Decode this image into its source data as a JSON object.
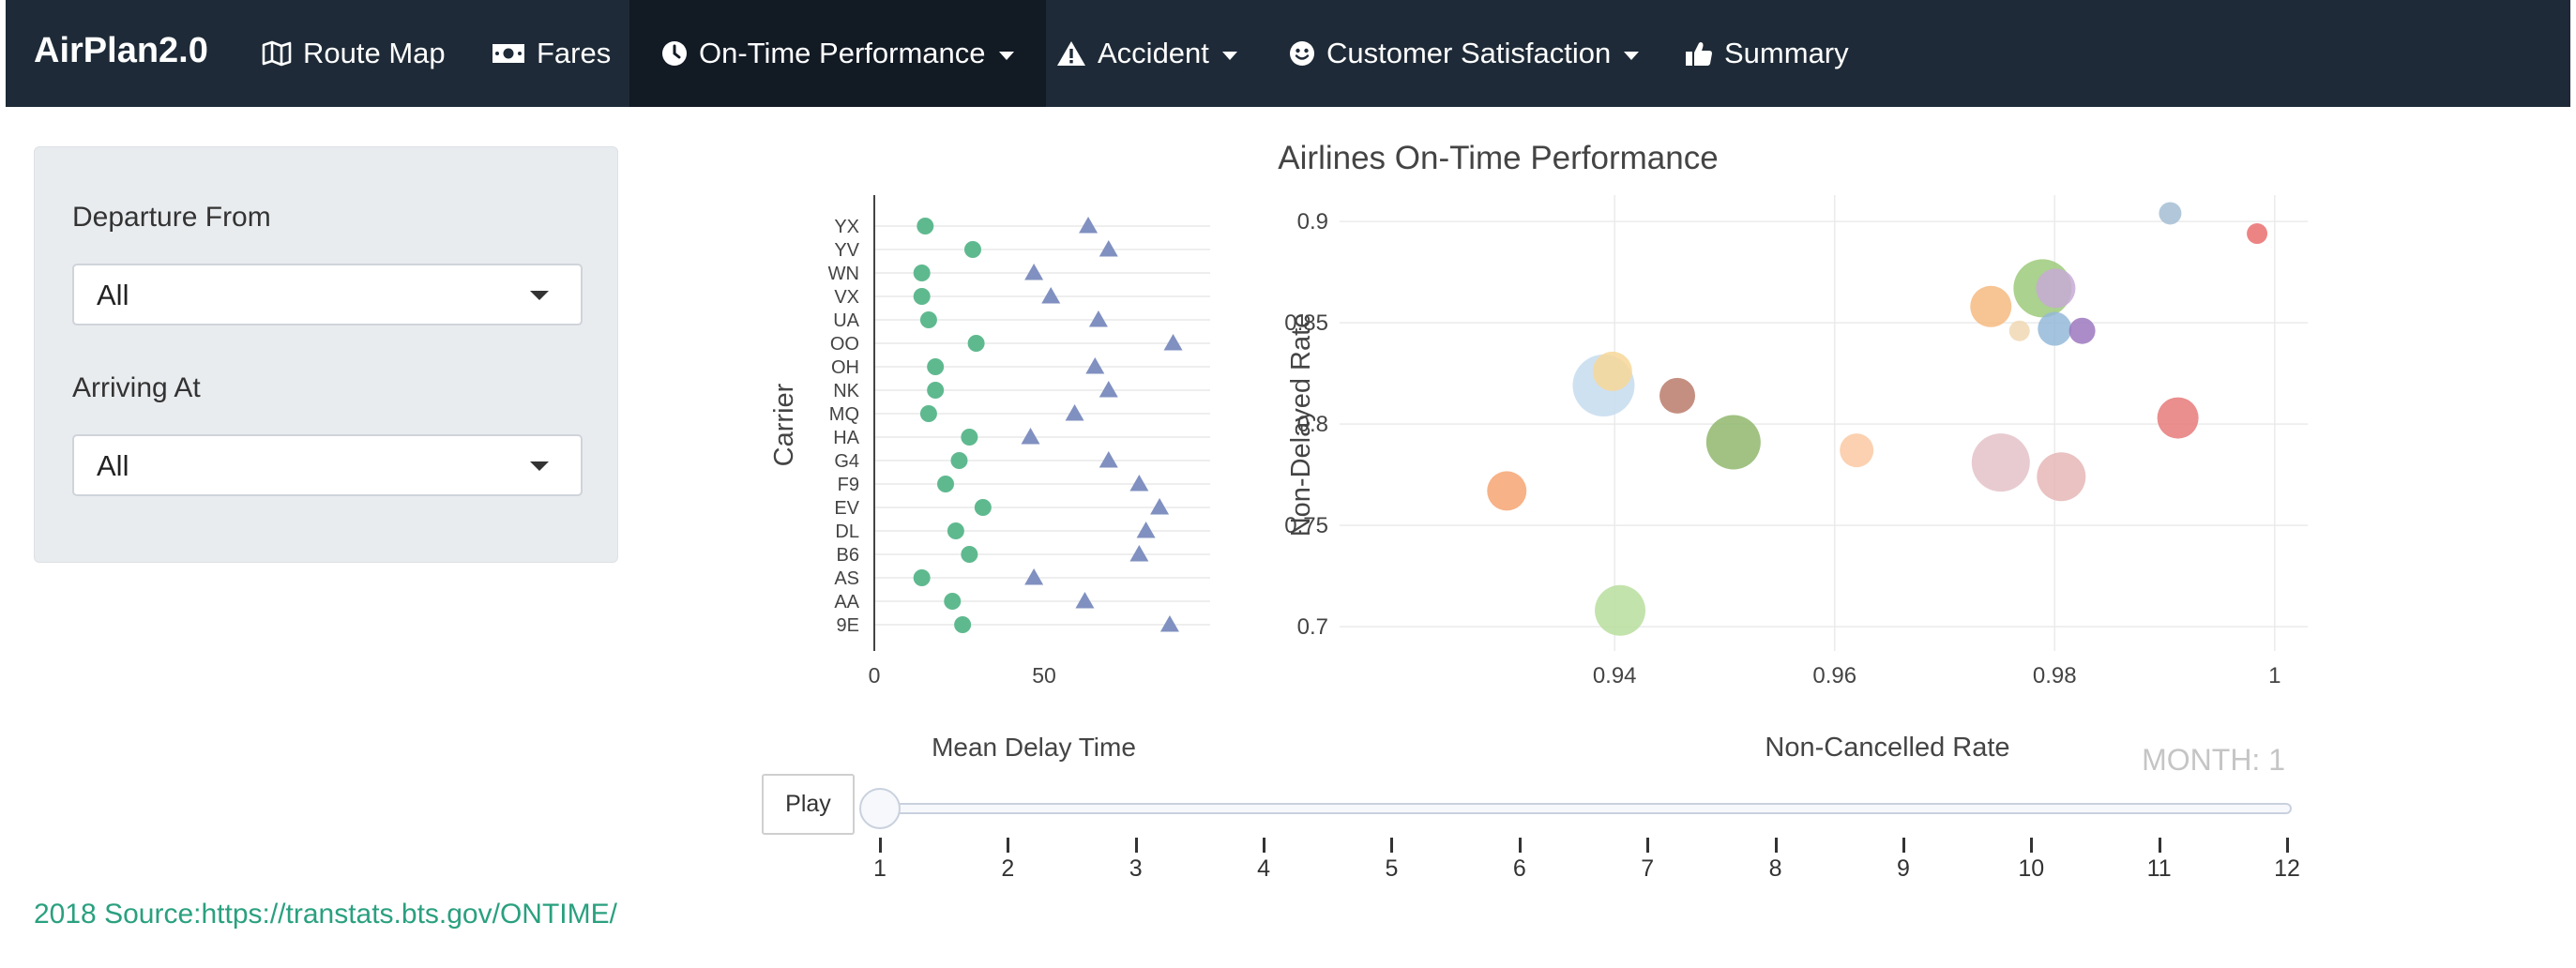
{
  "navbar": {
    "brand": "AirPlan2.0",
    "items": [
      {
        "id": "route-map",
        "label": "Route Map",
        "icon": "map-icon",
        "dropdown": false,
        "active": false
      },
      {
        "id": "fares",
        "label": "Fares",
        "icon": "money-icon",
        "dropdown": false,
        "active": false
      },
      {
        "id": "on-time-performance",
        "label": "On-Time Performance",
        "icon": "clock-icon",
        "dropdown": true,
        "active": true
      },
      {
        "id": "accident",
        "label": "Accident",
        "icon": "warning-icon",
        "dropdown": true,
        "active": false
      },
      {
        "id": "customer-satisfaction",
        "label": "Customer Satisfaction",
        "icon": "smile-icon",
        "dropdown": true,
        "active": false
      },
      {
        "id": "summary",
        "label": "Summary",
        "icon": "thumbs-up-icon",
        "dropdown": false,
        "active": false
      }
    ]
  },
  "sidebar": {
    "departure_label": "Departure From",
    "departure_value": "All",
    "arriving_label": "Arriving At",
    "arriving_value": "All"
  },
  "footer": {
    "source": "2018 Source:https://transtats.bts.gov/ONTIME/"
  },
  "slider": {
    "play_label": "Play",
    "current_label": "MONTH: 1",
    "current": 1,
    "min": 1,
    "max": 12,
    "ticks": [
      "1",
      "2",
      "3",
      "4",
      "5",
      "6",
      "7",
      "8",
      "9",
      "10",
      "11",
      "12"
    ]
  },
  "colors": {
    "navbar_bg": "#1e2a37",
    "navbar_active": "#121a24",
    "marker_circle": "#5fb98f",
    "marker_triangle": "#8090c0",
    "link": "#2aa07f"
  },
  "chart_data": [
    {
      "type": "scatter",
      "title": "",
      "xlabel": "Mean Delay Time",
      "ylabel": "Carrier",
      "xlim": [
        0,
        100
      ],
      "xticks": [
        0,
        50
      ],
      "categories": [
        "YX",
        "YV",
        "WN",
        "VX",
        "UA",
        "OO",
        "OH",
        "NK",
        "MQ",
        "HA",
        "G4",
        "F9",
        "EV",
        "DL",
        "B6",
        "AS",
        "AA",
        "9E"
      ],
      "series": [
        {
          "marker": "circle",
          "values": [
            15,
            29,
            14,
            14,
            16,
            30,
            18,
            18,
            16,
            28,
            25,
            21,
            32,
            24,
            28,
            14,
            23,
            26
          ]
        },
        {
          "marker": "triangle",
          "values": [
            63,
            69,
            47,
            52,
            66,
            88,
            65,
            69,
            59,
            46,
            69,
            78,
            84,
            80,
            78,
            47,
            62,
            87
          ]
        }
      ]
    },
    {
      "type": "scatter",
      "title": "Airlines On-Time Performance",
      "xlabel": "Non-Cancelled Rate",
      "ylabel": "Non-Delayed Rate",
      "xlim": [
        0.915,
        1.003
      ],
      "ylim": [
        0.688,
        0.913
      ],
      "xticks": [
        0.94,
        0.96,
        0.98,
        1
      ],
      "xtick_labels": [
        "0.94",
        "0.96",
        "0.98",
        "1"
      ],
      "yticks": [
        0.7,
        0.75,
        0.8,
        0.85,
        0.9
      ],
      "ytick_labels": [
        "0.7",
        "0.75",
        "0.8",
        "0.85",
        "0.9"
      ],
      "grid": true,
      "points": [
        {
          "x": 0.9905,
          "y": 0.904,
          "size": 12,
          "color": "#a4bed4"
        },
        {
          "x": 0.9984,
          "y": 0.894,
          "size": 11,
          "color": "#ea6f6f"
        },
        {
          "x": 0.9789,
          "y": 0.867,
          "size": 31,
          "color": "#9cca7a"
        },
        {
          "x": 0.9801,
          "y": 0.867,
          "size": 21,
          "color": "#c7aad6"
        },
        {
          "x": 0.9742,
          "y": 0.858,
          "size": 22,
          "color": "#f6ba80"
        },
        {
          "x": 0.9768,
          "y": 0.846,
          "size": 11,
          "color": "#f0d8b4"
        },
        {
          "x": 0.98,
          "y": 0.847,
          "size": 18,
          "color": "#94b9d8"
        },
        {
          "x": 0.9825,
          "y": 0.846,
          "size": 14,
          "color": "#9c78be"
        },
        {
          "x": 0.9398,
          "y": 0.826,
          "size": 21,
          "color": "#f7d799"
        },
        {
          "x": 0.939,
          "y": 0.819,
          "size": 33,
          "color": "#c6dcee"
        },
        {
          "x": 0.9457,
          "y": 0.814,
          "size": 19,
          "color": "#ba7b6b"
        },
        {
          "x": 0.9912,
          "y": 0.803,
          "size": 22,
          "color": "#e67a7a"
        },
        {
          "x": 0.9508,
          "y": 0.791,
          "size": 29,
          "color": "#90b76d"
        },
        {
          "x": 0.962,
          "y": 0.787,
          "size": 18,
          "color": "#fac9a3"
        },
        {
          "x": 0.9751,
          "y": 0.781,
          "size": 31,
          "color": "#e4c2c8"
        },
        {
          "x": 0.9806,
          "y": 0.774,
          "size": 26,
          "color": "#e6b7b7"
        },
        {
          "x": 0.9302,
          "y": 0.767,
          "size": 21,
          "color": "#f6a473"
        },
        {
          "x": 0.9405,
          "y": 0.708,
          "size": 27,
          "color": "#b9de9e"
        }
      ]
    }
  ]
}
